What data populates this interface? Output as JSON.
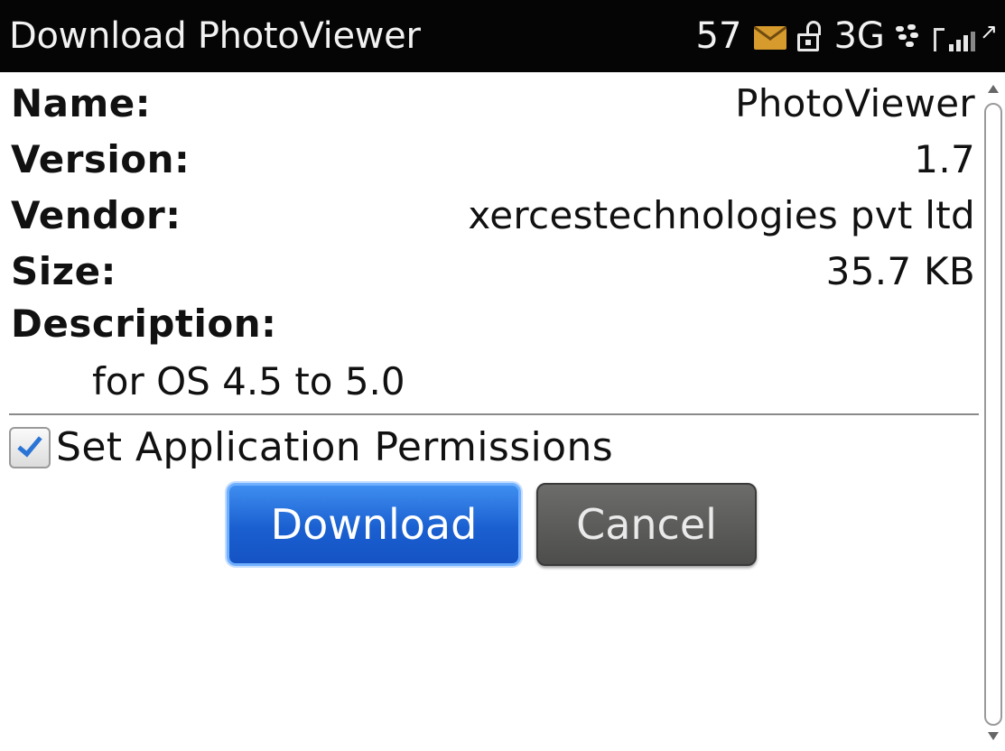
{
  "titlebar": {
    "title": "Download PhotoViewer",
    "status": {
      "message_count": "57",
      "network": "3G",
      "icons": [
        "envelope-icon",
        "unlock-icon",
        "blackberry-icon",
        "signal-icon"
      ]
    }
  },
  "fields": {
    "name": {
      "label": "Name:",
      "value": "PhotoViewer"
    },
    "version": {
      "label": "Version:",
      "value": "1.7"
    },
    "vendor": {
      "label": "Vendor:",
      "value": "xercestechnologies pvt ltd"
    },
    "size": {
      "label": "Size:",
      "value": "35.7 KB"
    },
    "description": {
      "label": "Description:",
      "value": "for OS 4.5 to 5.0"
    }
  },
  "permissions": {
    "label": "Set Application Permissions",
    "checked": true
  },
  "buttons": {
    "download": "Download",
    "cancel": "Cancel"
  },
  "colors": {
    "titlebar_bg": "#050505",
    "download_button": "#1a5fd0",
    "cancel_button": "#555654",
    "checkmark": "#2a74d6",
    "envelope": "#d79a2c"
  }
}
